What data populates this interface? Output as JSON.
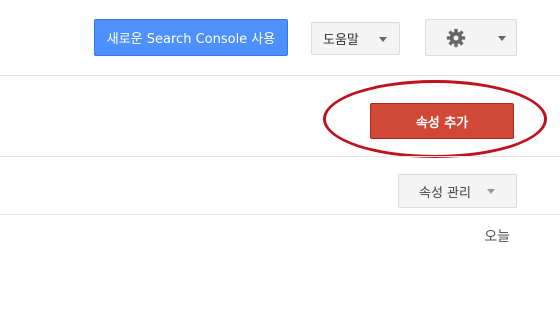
{
  "header": {
    "new_search_console_label": "새로운 Search Console 사용",
    "help_label": "도움말",
    "settings_icon": "gear-icon"
  },
  "toolbar": {
    "add_property_label": "속성 추가",
    "manage_property_label": "속성 관리"
  },
  "list": {
    "date_label": "오늘"
  },
  "colors": {
    "primary_blue": "#4d90fe",
    "action_red": "#d14836",
    "annotation_ring": "#c0121e"
  }
}
